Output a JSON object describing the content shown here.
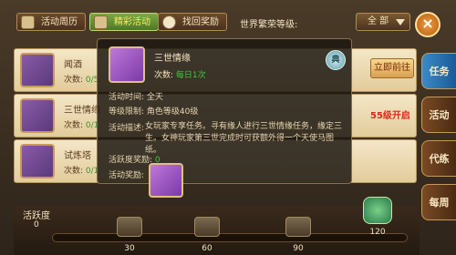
{
  "tabs": [
    {
      "label": "活动周历",
      "active": false,
      "icon": "calendar-icon"
    },
    {
      "label": "精彩活动",
      "active": true,
      "icon": "gift-icon"
    },
    {
      "label": "找回奖励",
      "active": false,
      "icon": "reward-icon"
    }
  ],
  "world": {
    "label": "世界繁荣等级:",
    "filter": "全 部"
  },
  "side_tabs": [
    "任务",
    "活动",
    "代练",
    "每周"
  ],
  "rows": [
    {
      "name": "闻酒",
      "count_prefix": "次数: ",
      "count": "0/5",
      "action": "立即前往",
      "icon": "exp-icon"
    },
    {
      "name": "三世情缘",
      "count_prefix": "次数: ",
      "count": "0/1",
      "action": "55级开启",
      "icon": "quill-icon"
    },
    {
      "name": "试炼塔",
      "count_prefix": "次数: ",
      "count": "0/1",
      "action": "",
      "icon": "mount-icon"
    }
  ],
  "activity": {
    "label": "活跃度",
    "value": "0",
    "milestones": [
      "30",
      "60",
      "90",
      "120"
    ]
  },
  "popup": {
    "title": "三世情缘",
    "times_label": "次数: ",
    "times_value": "每日1次",
    "badge": "典",
    "time_label": "活动时间: ",
    "time_value": "全天",
    "level_label": "等级限制: ",
    "level_value": "角色等级40级",
    "desc_label": "活动描述: ",
    "desc_value": "女玩家专享任务。寻有缘人进行三世情缘任务，缘定三生。女神玩家第三世完成时可获额外得一个天使马图纸。",
    "points_label": "活跃度奖励: ",
    "points_value": "0",
    "reward_label": "活动奖励:"
  },
  "colors": {
    "accent_green": "#3ac83a",
    "warn_red": "#d82a1a",
    "active_tab": "#4c7a22"
  }
}
